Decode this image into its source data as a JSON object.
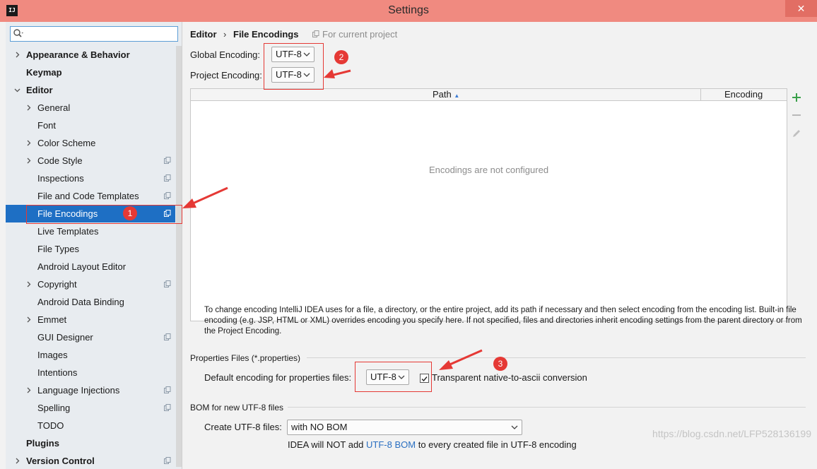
{
  "window": {
    "title": "Settings",
    "app_icon": "IJ",
    "close_glyph": "✕"
  },
  "sidebar": {
    "search_placeholder": "",
    "items": [
      {
        "label": "Appearance & Behavior",
        "bold": true,
        "chevron": "right"
      },
      {
        "label": "Keymap",
        "bold": true
      },
      {
        "label": "Editor",
        "bold": true,
        "chevron": "down"
      },
      {
        "label": "General",
        "chevron": "right"
      },
      {
        "label": "Font"
      },
      {
        "label": "Color Scheme",
        "chevron": "right"
      },
      {
        "label": "Code Style",
        "chevron": "right",
        "project_icon": true
      },
      {
        "label": "Inspections",
        "project_icon": true
      },
      {
        "label": "File and Code Templates",
        "project_icon": true
      },
      {
        "label": "File Encodings",
        "selected": true,
        "project_icon": true
      },
      {
        "label": "Live Templates"
      },
      {
        "label": "File Types"
      },
      {
        "label": "Android Layout Editor"
      },
      {
        "label": "Copyright",
        "chevron": "right",
        "project_icon": true
      },
      {
        "label": "Android Data Binding"
      },
      {
        "label": "Emmet",
        "chevron": "right"
      },
      {
        "label": "GUI Designer",
        "project_icon": true
      },
      {
        "label": "Images"
      },
      {
        "label": "Intentions"
      },
      {
        "label": "Language Injections",
        "chevron": "right",
        "project_icon": true
      },
      {
        "label": "Spelling",
        "project_icon": true
      },
      {
        "label": "TODO"
      },
      {
        "label": "Plugins",
        "bold": true
      },
      {
        "label": "Version Control",
        "bold": true,
        "chevron": "right",
        "project_icon": true
      }
    ]
  },
  "breadcrumb": {
    "parent": "Editor",
    "separator": "›",
    "current": "File Encodings",
    "scope_note": "For current project"
  },
  "encodings": {
    "global_label": "Global Encoding:",
    "global_value": "UTF-8",
    "project_label": "Project Encoding:",
    "project_value": "UTF-8"
  },
  "table": {
    "col_path": "Path",
    "sort_glyph": "▲",
    "col_encoding": "Encoding",
    "empty_text": "Encodings are not configured"
  },
  "help_text": "To change encoding IntelliJ IDEA uses for a file, a directory, or the entire project, add its path if necessary and then select encoding from the encoding list. Built-in file encoding (e.g. JSP, HTML or XML) overrides encoding you specify here. If not specified, files and directories inherit encoding settings from the parent directory or from the Project Encoding.",
  "properties": {
    "section_title": "Properties Files (*.properties)",
    "default_label": "Default encoding for properties files:",
    "default_value": "UTF-8",
    "transparent_label": "Transparent native-to-ascii conversion",
    "transparent_checked": true
  },
  "bom": {
    "section_title": "BOM for new UTF-8 files",
    "create_label": "Create UTF-8 files:",
    "create_value": "with NO BOM",
    "note_prefix": "IDEA will NOT add ",
    "note_link": "UTF-8 BOM",
    "note_suffix": " to every created file in UTF-8 encoding"
  },
  "annotations": {
    "marker_1": "1",
    "marker_2": "2",
    "marker_3": "3",
    "color": "#e53935"
  },
  "watermark": "https://blog.csdn.net/LFP528136199",
  "colors": {
    "titlebar": "#f08a80",
    "selection": "#1e6fc4",
    "add_icon": "#3aa04a"
  }
}
